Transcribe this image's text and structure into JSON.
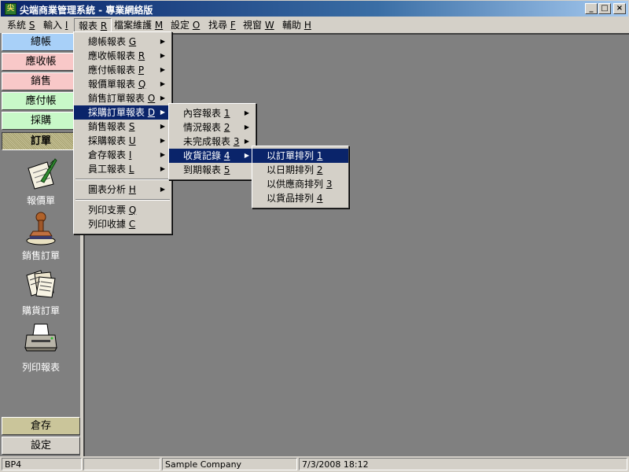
{
  "window": {
    "title": "尖端商業管理系統 - 專業網絡版",
    "app_icon": "尖",
    "controls": {
      "minimize": "_",
      "maximize": "□",
      "close": "×"
    }
  },
  "menubar": {
    "items": [
      {
        "label": "系統 ",
        "key": "S"
      },
      {
        "label": "輸入 ",
        "key": "I"
      },
      {
        "label": "報表 ",
        "key": "R"
      },
      {
        "label": "檔案維護 ",
        "key": "M"
      },
      {
        "label": "設定 ",
        "key": "O"
      },
      {
        "label": "找尋 ",
        "key": "F"
      },
      {
        "label": "視窗 ",
        "key": "W"
      },
      {
        "label": "輔助 ",
        "key": "H"
      }
    ]
  },
  "report_menu": {
    "items": [
      {
        "label": "總帳報表 ",
        "key": "G"
      },
      {
        "label": "應收帳報表 ",
        "key": "R"
      },
      {
        "label": "應付帳報表 ",
        "key": "P"
      },
      {
        "label": "報價單報表 ",
        "key": "Q"
      },
      {
        "label": "銷售訂單報表 ",
        "key": "O"
      },
      {
        "label": "採購訂單報表 ",
        "key": "D"
      },
      {
        "label": "銷售報表 ",
        "key": "S"
      },
      {
        "label": "採購報表 ",
        "key": "U"
      },
      {
        "label": "倉存報表 ",
        "key": "I"
      },
      {
        "label": "員工報表 ",
        "key": "L"
      },
      {
        "label": "圖表分析 ",
        "key": "H"
      },
      {
        "label": "列印支票 ",
        "key": "Q"
      },
      {
        "label": "列印收據 ",
        "key": "C"
      }
    ]
  },
  "purchase_order_submenu": {
    "items": [
      {
        "label": "內容報表 ",
        "key": "1"
      },
      {
        "label": "情況報表 ",
        "key": "2"
      },
      {
        "label": "未完成報表 ",
        "key": "3"
      },
      {
        "label": "收貨記錄 ",
        "key": "4"
      },
      {
        "label": "到期報表 ",
        "key": "5"
      }
    ]
  },
  "receiving_submenu": {
    "items": [
      {
        "label": "以訂單排列 ",
        "key": "1"
      },
      {
        "label": "以日期排列 ",
        "key": "2"
      },
      {
        "label": "以供應商排列 ",
        "key": "3"
      },
      {
        "label": "以貨品排列 ",
        "key": "4"
      }
    ]
  },
  "sidebar": {
    "modules": [
      {
        "label": "總帳",
        "color": "#a8d0f8"
      },
      {
        "label": "應收帳",
        "color": "#f8c8c8"
      },
      {
        "label": "銷售",
        "color": "#f8c8c8"
      },
      {
        "label": "應付帳",
        "color": "#c8f8c8"
      },
      {
        "label": "採購",
        "color": "#c8f8c8"
      },
      {
        "label": "訂單",
        "color": "#cac59a"
      }
    ],
    "tools": [
      {
        "label": "報價單",
        "icon": "quill-document-icon"
      },
      {
        "label": "銷售訂單",
        "icon": "stamp-icon"
      },
      {
        "label": "購貨訂單",
        "icon": "papers-icon"
      },
      {
        "label": "列印報表",
        "icon": "printer-icon"
      }
    ],
    "bottom": [
      {
        "label": "倉存",
        "color": "#cac59a"
      },
      {
        "label": "設定",
        "color": "#d4d0c8"
      }
    ]
  },
  "statusbar": {
    "code": "BP4",
    "empty": "",
    "company": "Sample Company",
    "datetime": "7/3/2008 18:12"
  },
  "colors": {
    "highlight": "#0a246a",
    "workspace": "#808080",
    "face": "#d4d0c8"
  }
}
